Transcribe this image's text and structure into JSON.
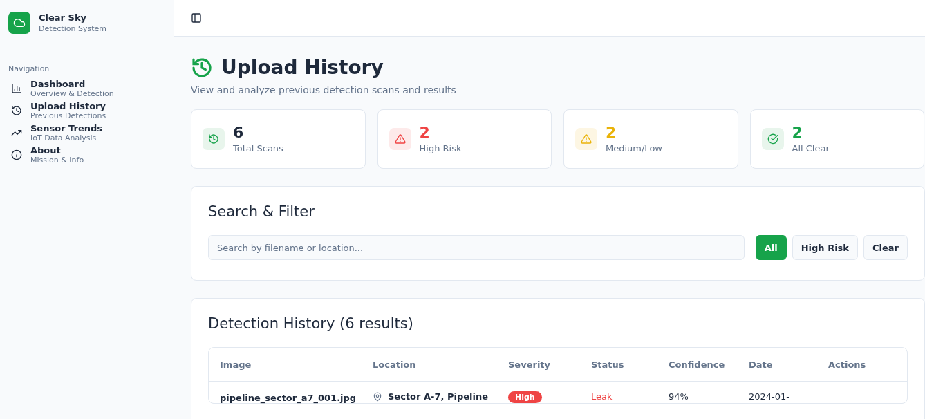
{
  "brand": {
    "name": "Clear Sky",
    "subtitle": "Detection System"
  },
  "sidebar": {
    "heading": "Navigation",
    "items": [
      {
        "label": "Dashboard",
        "sub": "Overview & Detection"
      },
      {
        "label": "Upload History",
        "sub": "Previous Detections"
      },
      {
        "label": "Sensor Trends",
        "sub": "IoT Data Analysis"
      },
      {
        "label": "About",
        "sub": "Mission & Info"
      }
    ]
  },
  "page": {
    "title": "Upload History",
    "subtitle": "View and analyze previous detection scans and results"
  },
  "stats": [
    {
      "kind": "history",
      "value": "6",
      "label": "Total Scans"
    },
    {
      "kind": "high",
      "value": "2",
      "label": "High Risk"
    },
    {
      "kind": "medium",
      "value": "2",
      "label": "Medium/Low"
    },
    {
      "kind": "clear",
      "value": "2",
      "label": "All Clear"
    }
  ],
  "filter": {
    "title": "Search & Filter",
    "placeholder": "Search by filename or location...",
    "buttons": [
      {
        "label": "All",
        "selected": true
      },
      {
        "label": "High Risk",
        "selected": false
      },
      {
        "label": "Clear",
        "selected": false
      }
    ]
  },
  "history": {
    "title": "Detection History (6 results)",
    "columns": [
      "Image",
      "Location",
      "Severity",
      "Status",
      "Confidence",
      "Date",
      "Actions"
    ],
    "rows": [
      {
        "file": "pipeline_sector_a7_001.jpg",
        "location": "Sector A-7, Pipeline",
        "severity": "High",
        "status": "Leak",
        "confidence": "94%",
        "date": "2024-01-"
      }
    ]
  }
}
